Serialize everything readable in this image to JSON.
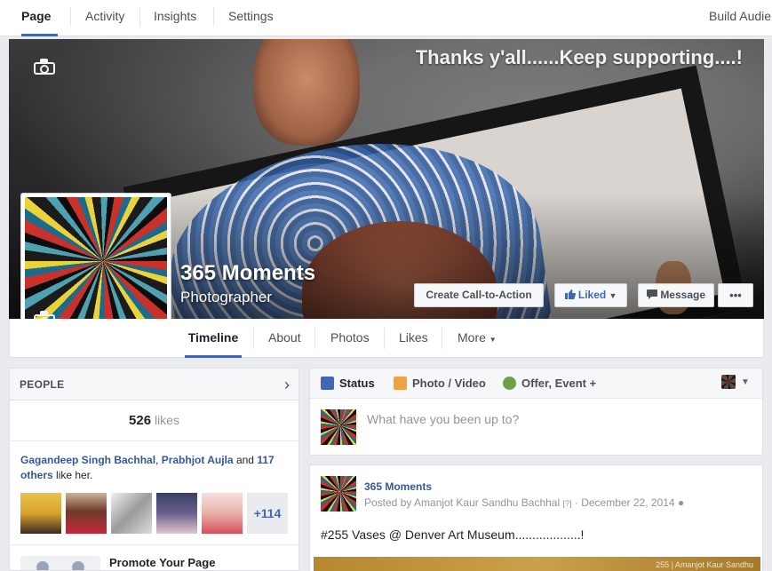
{
  "topnav": {
    "tabs": [
      "Page",
      "Activity",
      "Insights",
      "Settings"
    ],
    "right_link": "Build Audie"
  },
  "cover": {
    "caption": "Thanks y'all......Keep supporting....!"
  },
  "page": {
    "name": "365 Moments",
    "category": "Photographer"
  },
  "actions": {
    "cta": "Create Call-to-Action",
    "liked": "Liked",
    "message": "Message",
    "more": "•••"
  },
  "timeline_tabs": [
    "Timeline",
    "About",
    "Photos",
    "Likes",
    "More"
  ],
  "people": {
    "title": "PEOPLE",
    "likes_count": "526",
    "likes_word": "likes",
    "friend1": "Gagandeep Singh Bachhal",
    "friend2": "Prabhjot Aujla",
    "and_text": "and",
    "others": "117 others",
    "like_her": "like her.",
    "more_count": "+114"
  },
  "promote": {
    "label": "Promote Your Page"
  },
  "composer": {
    "tab_status": "Status",
    "tab_photo": "Photo / Video",
    "tab_offer": "Offer, Event +",
    "placeholder": "What have you been up to?"
  },
  "post": {
    "author": "365 Moments",
    "posted_by": "Posted by Amanjot Kaur Sandhu Bachhal",
    "question": "[?]",
    "date": "December 22, 2014",
    "text": "#255 Vases @ Denver Art Museum...................!",
    "image_caption": "255  |  Amanjot Kaur Sandhu"
  },
  "colors": {
    "brand": "#4267b2",
    "link": "#365899",
    "background": "#e9ebee"
  }
}
